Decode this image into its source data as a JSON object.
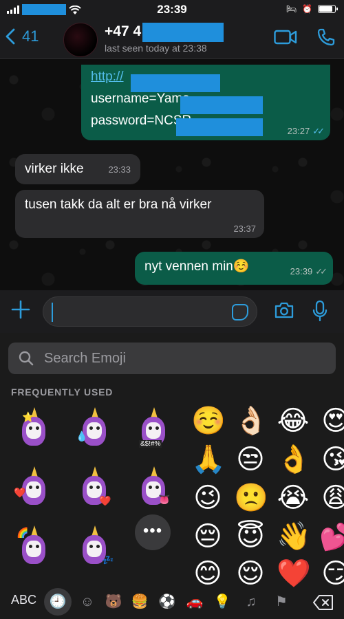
{
  "status_bar": {
    "time": "23:39"
  },
  "header": {
    "back_count": "41",
    "contact_name": "+47 4",
    "last_seen": "last seen today at 23:38"
  },
  "messages": [
    {
      "direction": "out",
      "lines": [
        "http://",
        "username=Yama",
        "password=NCSR"
      ],
      "time": "23:27",
      "status": "read"
    },
    {
      "direction": "in",
      "text": "virker ikke",
      "time": "23:33"
    },
    {
      "direction": "in",
      "text": "tusen takk da alt er bra nå virker",
      "time": "23:37"
    },
    {
      "direction": "out",
      "text": "nyt vennen min☺️",
      "time": "23:39",
      "status": "delivered"
    }
  ],
  "keyboard": {
    "search_placeholder": "Search Emoji",
    "section_label": "FREQUENTLY USED",
    "abc_label": "ABC",
    "sticker_accessories": [
      "⭐",
      "💧",
      "&$!#%",
      "❤️",
      "❤️",
      "👅",
      "🌈",
      "💤"
    ],
    "emojis": [
      "☺️",
      "👌🏻",
      "😂",
      "😍",
      "🙏",
      "😒",
      "👌",
      "😘",
      "😉",
      "🙁",
      "😭",
      "😩",
      "😔",
      "😇",
      "👋",
      "💕",
      "😊",
      "😌",
      "❤️",
      "😏"
    ],
    "categories": [
      "clock-icon",
      "smiley-icon",
      "bear-icon",
      "food-icon",
      "ball-icon",
      "car-icon",
      "lightbulb-icon",
      "symbols-icon",
      "flag-icon"
    ]
  },
  "colors": {
    "accent": "#2d9cdb",
    "outgoing_bubble": "#0b5c48",
    "incoming_bubble": "#2c2c2e",
    "read_tick": "#53bdeb"
  }
}
